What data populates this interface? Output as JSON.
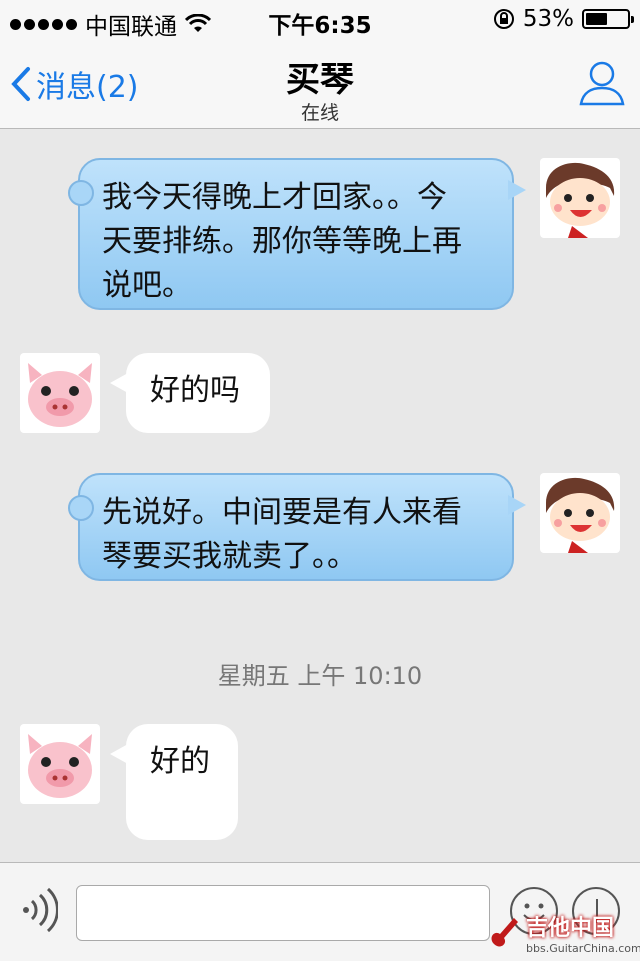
{
  "status_bar": {
    "carrier": "中国联通",
    "time": "下午6:35",
    "battery_percent": "53%",
    "battery_level": 0.53
  },
  "nav": {
    "back_label": "消息(2)",
    "title": "买琴",
    "subtitle": "在线"
  },
  "messages": [
    {
      "sender": "me",
      "text_lines": [
        "我今天得晚上才回家。。今",
        "天要排练。那你等等晚上再",
        "说吧。"
      ]
    },
    {
      "sender": "other",
      "text": "好的吗"
    },
    {
      "sender": "me",
      "text_lines": [
        "先说好。中间要是有人来看",
        "琴要买我就卖了。。"
      ]
    },
    {
      "sender": "other",
      "text": "好的"
    }
  ],
  "timestamp": "星期五 上午 10:10",
  "input": {
    "value": "",
    "placeholder": ""
  },
  "watermark": {
    "main": "吉他中国",
    "sub": "bbs.GuitarChina.com"
  },
  "colors": {
    "accent": "#1a7ae6",
    "bubble_out": "#a9d6f7",
    "bubble_in": "#ffffff",
    "chat_bg": "#e8e8e8"
  }
}
